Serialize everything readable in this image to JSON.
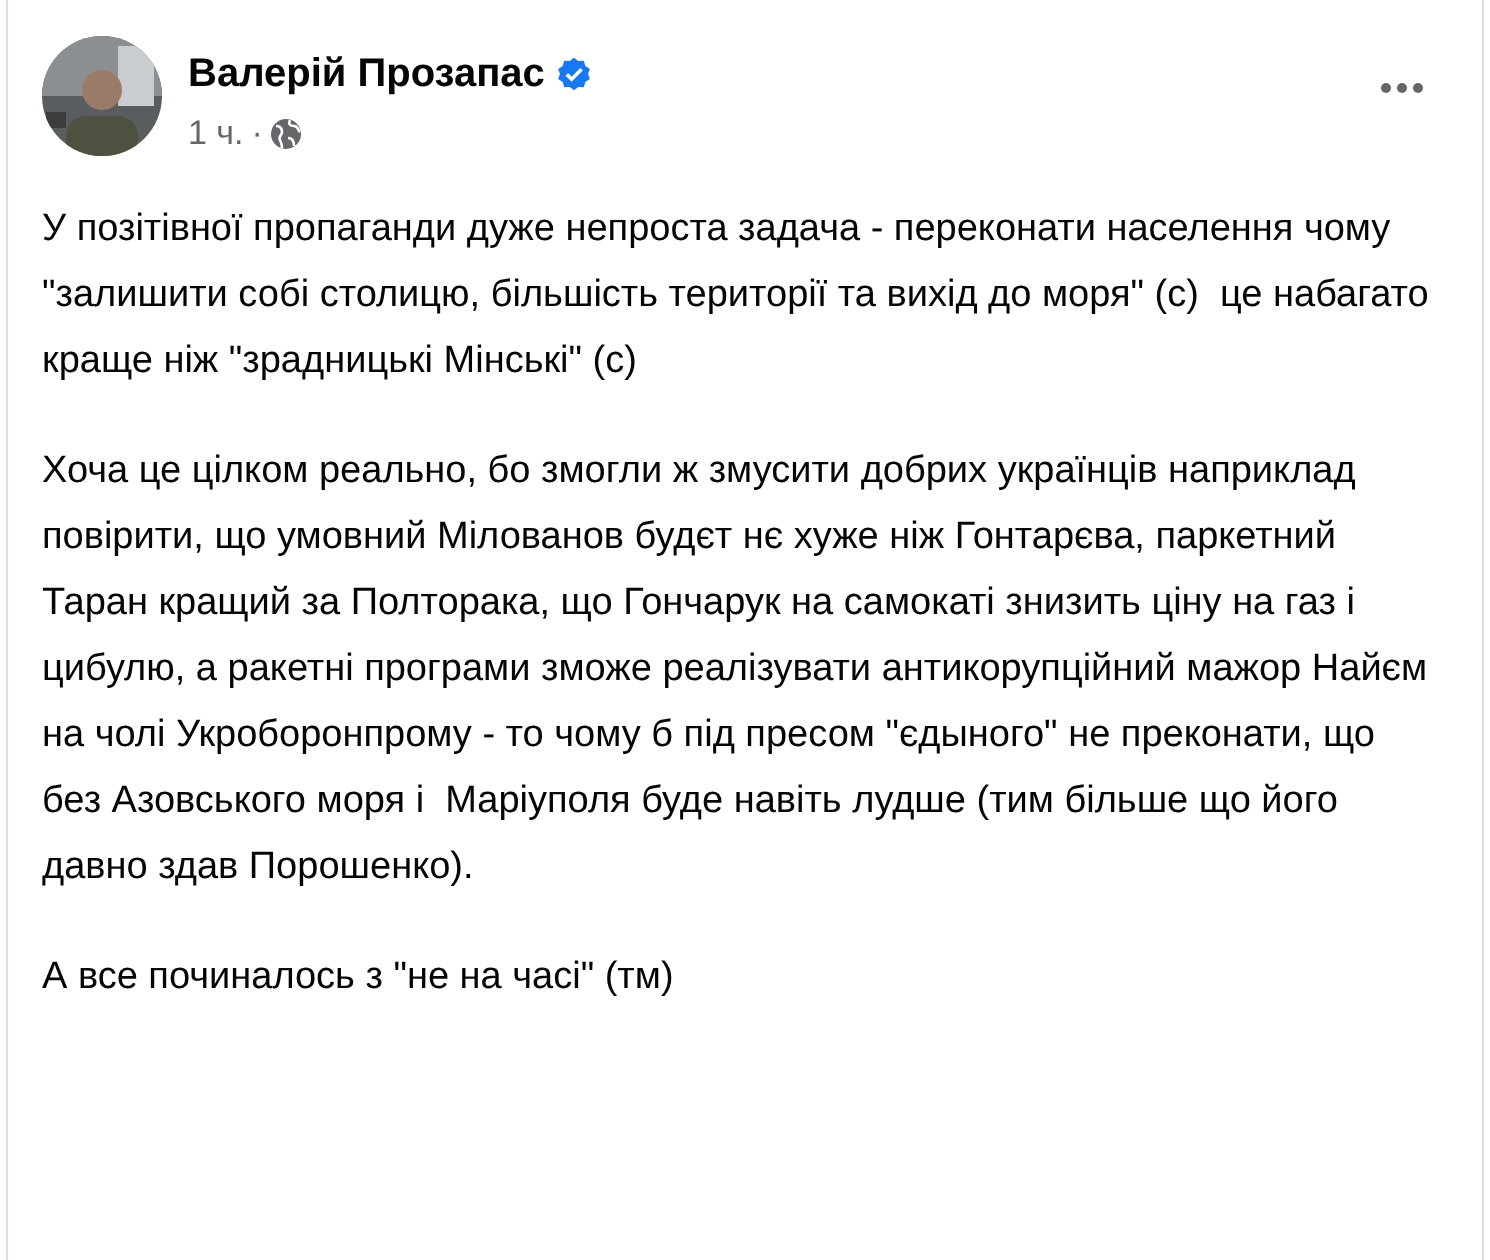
{
  "post": {
    "author": "Валерій Прозапас",
    "verified": true,
    "time": "1 ч.",
    "separator": "·",
    "paragraphs": [
      "У позітівної пропаганди дуже непроста задача - переконати населення чому \"залишити собі столицю, більшість території та вихід до моря\" (с)  це набагато краще ніж \"зрадницькі Мінські\" (с)",
      "Хоча це цілком реально, бо змогли ж змусити добрих українців наприклад повірити, що умовний Мілованов будєт нє хуже ніж Гонтарєва, паркетний Таран кращий за Полторака, що Гончарук на самокаті знизить ціну на газ і цибулю, а ракетні програми зможе реалізувати антикорупційний мажор Найєм на чолі Укроборонпрому - то чому б під пресом \"єдыного\" не преконати, що без Азовського моря і  Маріуполя буде навіть лудше (тим більше що його давно здав Порошенко).",
      "А все починалось з \"не на часі\" (тм)"
    ]
  }
}
